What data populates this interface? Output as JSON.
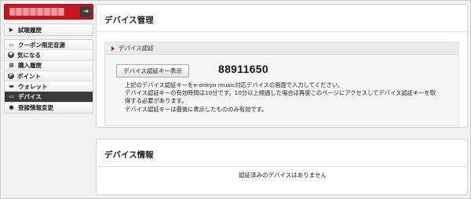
{
  "sidebar": {
    "user_name": "",
    "history_item": {
      "label": "試聴履歴",
      "icon": "play-triangle-icon"
    },
    "menu": [
      {
        "label": "クーポン限定音源",
        "icon": "ticket-icon"
      },
      {
        "label": "気になる",
        "icon": "heart-icon"
      },
      {
        "label": "購入履歴",
        "icon": "cart-icon"
      },
      {
        "label": "ポイント",
        "icon": "points-icon"
      },
      {
        "label": "ウォレット",
        "icon": "wallet-icon"
      },
      {
        "label": "デバイス",
        "icon": "device-icon",
        "active": true
      },
      {
        "label": "登録情報変更",
        "icon": "user-icon"
      }
    ]
  },
  "device_management": {
    "title": "デバイス管理",
    "auth": {
      "heading": "デバイス認証",
      "button_label": "デバイス認証キー表示",
      "code": "88911650",
      "lines": [
        "上記のデバイス認証キーをe-onkyo music対応デバイスの画面で入力してください。",
        "デバイス認証キーの有効時間は10分です。10分以上経過した場合は再度このページにアクセスしてデバイス認証キーを取",
        "得する必要があります。",
        "デバイス認証キーは最後に表示したもののみ有効です。"
      ]
    }
  },
  "device_info": {
    "title": "デバイス情報",
    "message": "認証済みのデバイスはありません"
  },
  "colors": {
    "accent": "#c8141e",
    "active_bg": "#3a3a3a"
  }
}
